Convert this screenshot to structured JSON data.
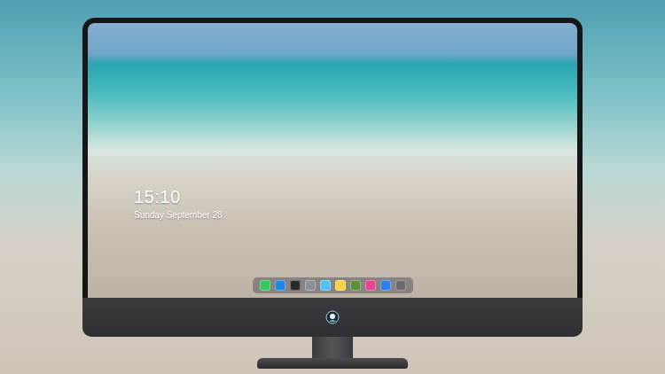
{
  "lock_screen": {
    "time": "15:10",
    "date": "Sunday September 28"
  },
  "dock": {
    "apps": [
      {
        "color": "#34c759"
      },
      {
        "color": "#1e88e5"
      },
      {
        "color": "#2b2b2b"
      },
      {
        "color": "#8a8f98"
      },
      {
        "color": "#4fc3f7"
      },
      {
        "color": "#f7d046"
      },
      {
        "color": "#5b8f3a"
      },
      {
        "color": "#e84393"
      },
      {
        "color": "#2f80ed"
      },
      {
        "color": "#6b6b6b"
      }
    ]
  }
}
